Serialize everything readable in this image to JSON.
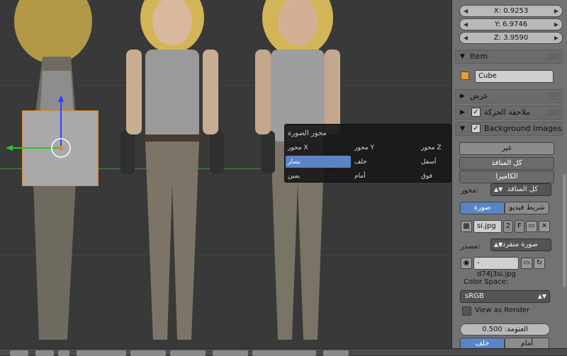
{
  "transform": {
    "x_field": "X: 0.9253",
    "y_field": "Y: 6.9746",
    "z_field": "Z: 3.9590"
  },
  "item_panel": {
    "header": "Item",
    "object_name": "Cube"
  },
  "sections": {
    "display": "عرض",
    "motion_tracking": "ملاحقة الحركة",
    "background_images": "Background Images"
  },
  "background_image": {
    "axis_label": "محور:",
    "axis_value": "كل المنافذ",
    "tab_image": "صورة",
    "tab_movie": "شريط فيديو",
    "image_name": "si.jpg",
    "users_count": "2",
    "fake_user": "F",
    "source_label": "مصدر:",
    "source_value": "صورة منفردة",
    "file_path": "-d74j3si.jpg",
    "color_space_label": "Color Space:",
    "color_space_value": "sRGB",
    "view_as_render": "View as Render",
    "opacity_field": "العتومة: 0.500",
    "btn_front": "أمام",
    "btn_back": "خلف"
  },
  "popup": {
    "title": "محور الصورة",
    "col_x": "محور X",
    "col_y": "محور Y",
    "col_z": "محور Z",
    "right_col_top": "غير",
    "right_col_all": "كل المنافذ",
    "right_col_camera": "الكاميرا",
    "x_opt1": "يسار",
    "x_opt2": "يمين",
    "y_opt1": "خلف",
    "y_opt2": "أمام",
    "z_opt1": "أسفل",
    "z_opt2": "فوق"
  },
  "colors": {
    "accent": "#5b84c6",
    "panel_bg": "#727272",
    "viewport_bg": "#393939"
  }
}
